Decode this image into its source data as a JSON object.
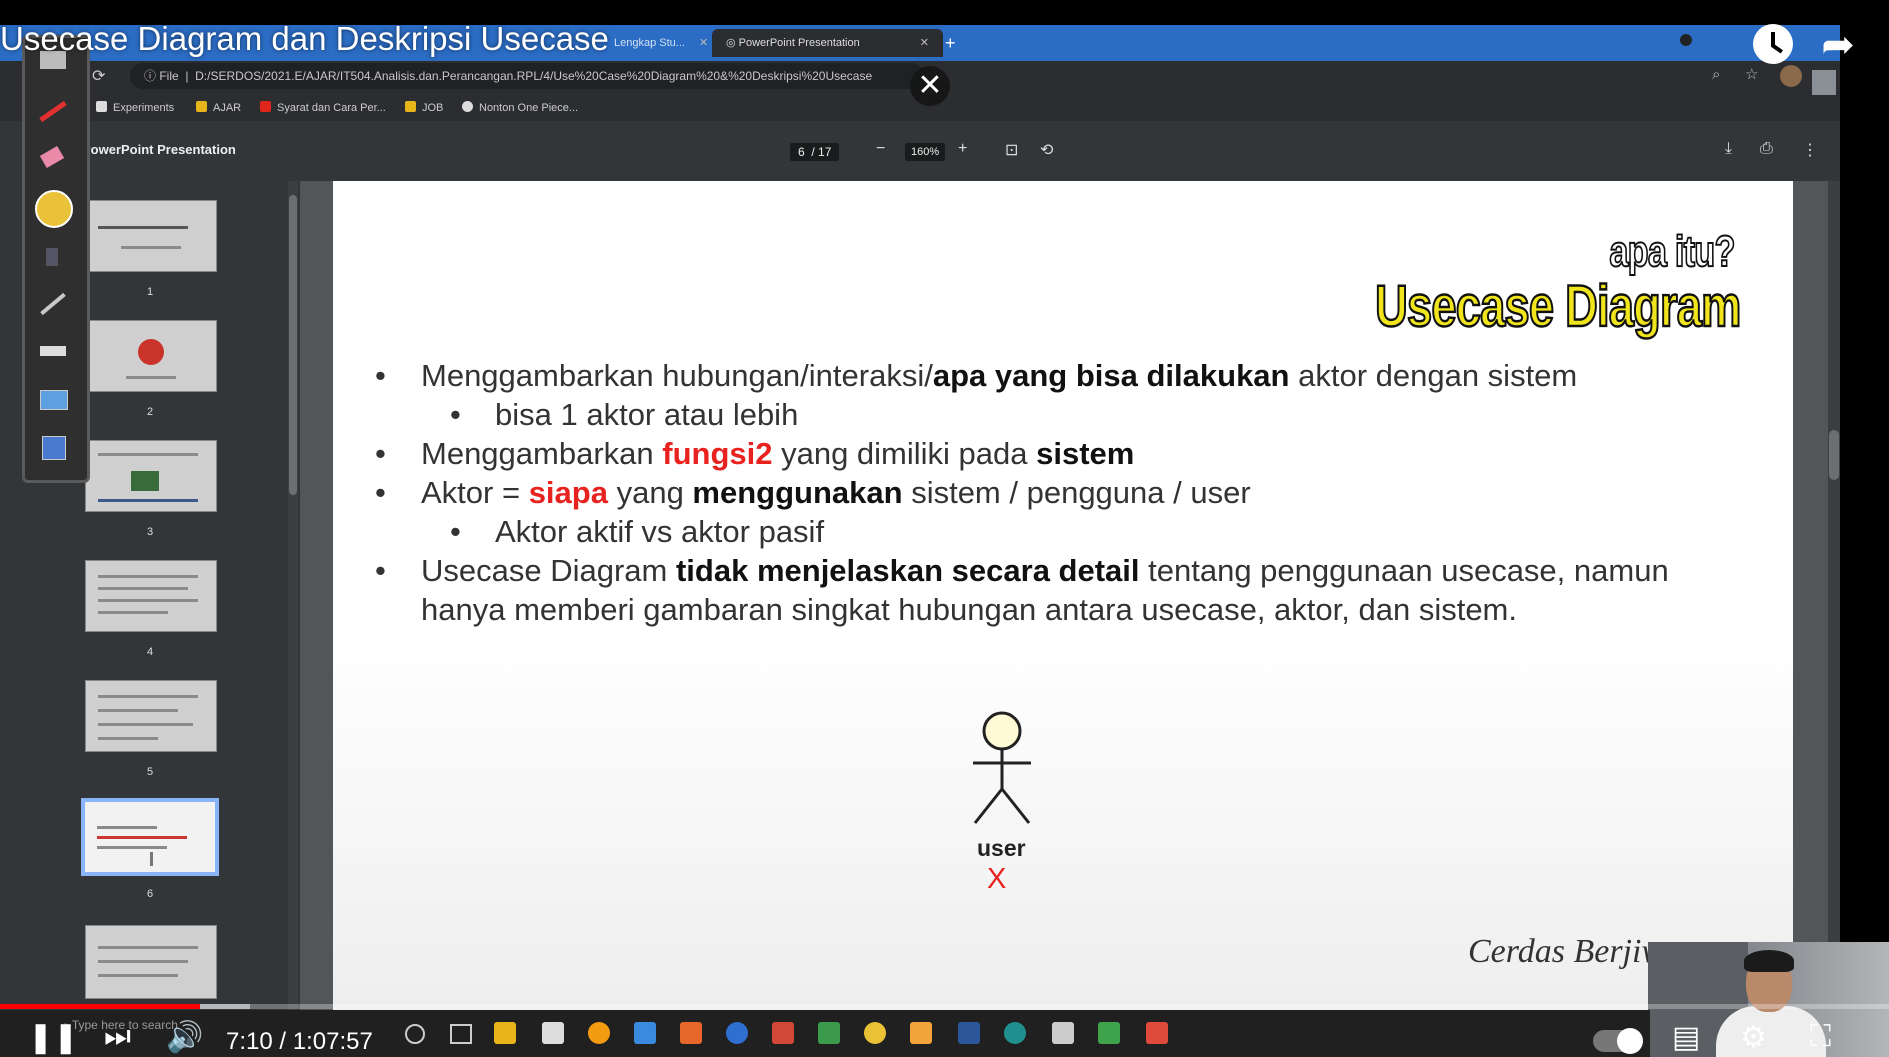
{
  "video": {
    "title": "Usecase Diagram dan Deskripsi Usecase",
    "current_time": "7:10",
    "duration": "1:07:57",
    "progress_fraction": 0.106
  },
  "browser": {
    "tabs": [
      {
        "label": "Lengkap Stu...",
        "active": false
      },
      {
        "label": "PowerPoint Presentation",
        "active": true
      }
    ],
    "url_scheme": "File",
    "url": "D:/SERDOS/2021.E/AJAR/IT504.Analisis.dan.Perancangan.RPL/4/Use%20Case%20Diagram%20&%20Deskripsi%20Usecase",
    "bookmarks": [
      "Experiments",
      "AJAR",
      "Syarat dan Cara Per...",
      "JOB",
      "Nonton One Piece..."
    ]
  },
  "pdf": {
    "title": "PowerPoint Presentation",
    "current_page": "6",
    "total_pages": "/ 17",
    "zoom": "160%",
    "thumbnails": [
      "1",
      "2",
      "3",
      "4",
      "5",
      "6"
    ],
    "selected_thumbnail": "6"
  },
  "slide": {
    "pre_title": "apa itu?",
    "title": "Usecase Diagram",
    "b1_pre": "Menggambarkan hubungan/interaksi/",
    "b1_bold": "apa yang bisa dilakukan",
    "b1_post": " aktor dengan sistem",
    "b1_sub": "bisa 1 aktor atau lebih",
    "b2_pre": "Menggambarkan ",
    "b2_red": "fungsi2",
    "b2_mid": " yang dimiliki pada ",
    "b2_bold": "sistem",
    "b3_pre": "Aktor = ",
    "b3_red": "siapa",
    "b3_mid": " yang ",
    "b3_bold": "menggunakan",
    "b3_post": " sistem / pengguna / user",
    "b3_sub": "Aktor aktif vs aktor pasif",
    "b4_pre": "Usecase Diagram ",
    "b4_bold": "tidak menjelaskan secara detail",
    "b4_post": " tentang penggunaan usecase, namun hanya memberi gambaran singkat hubungan antara usecase, aktor, dan sistem.",
    "actor_label": "user",
    "cross": "X",
    "signature": "Cerdas Berjiwa"
  },
  "taskbar": {
    "search_placeholder": "Type here to search"
  },
  "colors": {
    "accent_red": "#e8221e",
    "title_yellow": "#f0e51c",
    "progress_red": "#ff0000",
    "tab_blue": "#2b6cc4"
  }
}
